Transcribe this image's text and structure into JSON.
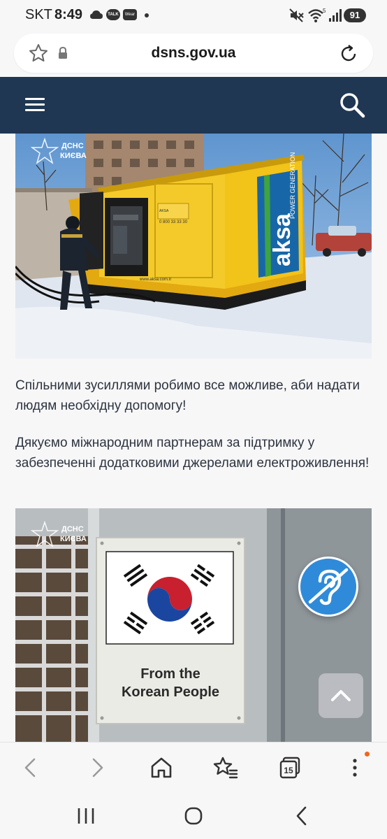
{
  "status_bar": {
    "carrier": "SKT",
    "time": "8:49",
    "talk_badge": "TALK",
    "wear_badge": "Wear",
    "battery": "91"
  },
  "browser": {
    "url": "dsns.gov.ua"
  },
  "article": {
    "photo1_watermark_line1": "ДСНС",
    "photo1_watermark_line2": "КИЄВА",
    "photo1_generator_brand": "aksa",
    "photo1_generator_sub": "POWER GENERATION",
    "paragraph1": "Спільними зусиллями робимо все можливе, аби надати людям необхідну допомогу!",
    "paragraph2": "Дякуємо міжнародним партнерам за підтримку у забезпеченні додатковими джерелами електроживлення!",
    "photo2_watermark_line1": "ДСНС",
    "photo2_watermark_line2": "КИЄВА",
    "photo2_sign_line1": "From the",
    "photo2_sign_line2": "Korean People"
  },
  "browser_toolbar": {
    "tabs_count": "15"
  },
  "colors": {
    "header_bg": "#1f3752",
    "a11y_button": "#2f8bd9",
    "generator_yellow": "#f2c318",
    "aksa_blue": "#1767a8",
    "badge_orange": "#f06522"
  },
  "icons": {
    "bookmark": "star-outline-icon",
    "lock": "lock-icon",
    "reload": "reload-icon",
    "menu": "hamburger-icon",
    "search": "search-icon",
    "accessibility": "hearing-icon",
    "scroll_top": "chevron-up-icon",
    "back": "chevron-left-icon",
    "forward": "chevron-right-icon",
    "home": "home-icon",
    "bookmarks": "star-list-icon",
    "tabs": "tabs-icon",
    "more": "kebab-menu-icon",
    "recents": "recents-icon",
    "home_nav": "circle-home-icon",
    "back_nav": "back-nav-icon"
  }
}
